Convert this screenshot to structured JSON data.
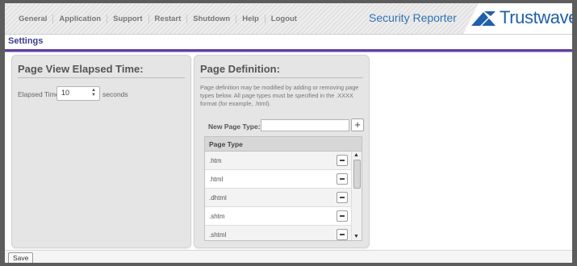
{
  "nav": [
    "General",
    "Application",
    "Support",
    "Restart",
    "Shutdown",
    "Help",
    "Logout"
  ],
  "product_name": "Security Reporter",
  "logo": {
    "text": "Trustwave",
    "reg": "®"
  },
  "settings_title": "Settings",
  "elapsed": {
    "title": "Page View Elapsed Time:",
    "label": "Elapsed Time:",
    "value": "10",
    "unit": "seconds"
  },
  "definition": {
    "title": "Page Definition:",
    "description": "Page definition may be modified by adding or removing page types below. All page types must be specified in the .XXXX format (for example, .html).",
    "new_label": "New Page Type:",
    "new_value": "",
    "column": "Page Type",
    "types": [
      ".htm",
      ".html",
      ".dhtml",
      ".shtm",
      ".shtml"
    ]
  },
  "save_label": "Save",
  "colors": {
    "accent": "#5f3fa0",
    "brand": "#1f5fab",
    "link": "#2f72b5"
  }
}
